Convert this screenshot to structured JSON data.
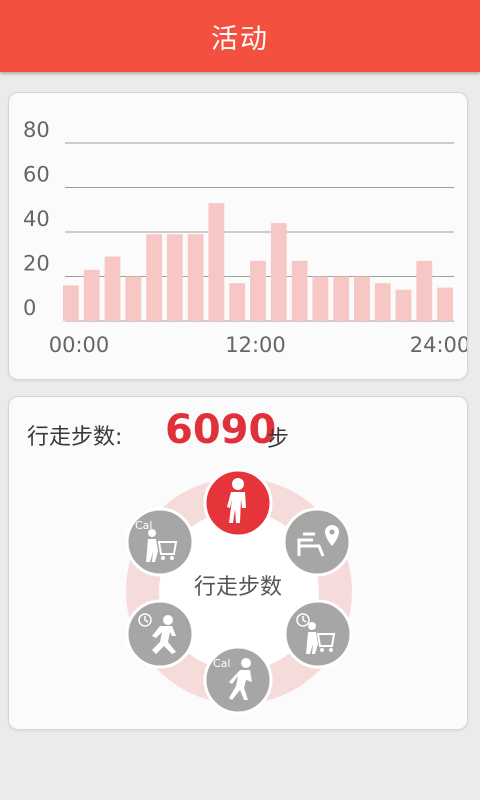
{
  "header": {
    "title": "活动"
  },
  "chart_data": {
    "type": "bar",
    "y_ticks": [
      "80",
      "60",
      "40",
      "20",
      "0"
    ],
    "x_labels": [
      "00:00",
      "12:00",
      "24:00"
    ],
    "values": [
      16,
      23,
      29,
      20,
      39,
      39,
      39,
      53,
      17,
      27,
      44,
      27,
      20,
      20,
      20,
      17,
      14,
      27,
      15
    ],
    "ylim": [
      0,
      80
    ],
    "grid": true,
    "bar_color": "#f6c7c4",
    "grid_color": "#9e9e9e"
  },
  "steps": {
    "label": "行走步数:",
    "value": "6090",
    "unit": "步",
    "center_label": "行走步数",
    "accent_color": "#e0303a"
  },
  "menu": [
    {
      "name": "walking-steps-button",
      "icon": "walking-person-icon",
      "active": true
    },
    {
      "name": "route-location-button",
      "icon": "route-location-icon",
      "active": false
    },
    {
      "name": "shopping-time-button",
      "icon": "cart-clock-icon",
      "active": false
    },
    {
      "name": "walking-calories-button",
      "icon": "walking-calories-icon",
      "active": false
    },
    {
      "name": "running-time-button",
      "icon": "running-clock-icon",
      "active": false
    },
    {
      "name": "shopping-calories-button",
      "icon": "cart-calories-icon",
      "active": false
    }
  ],
  "icon_labels": {
    "cal": "Cal"
  }
}
